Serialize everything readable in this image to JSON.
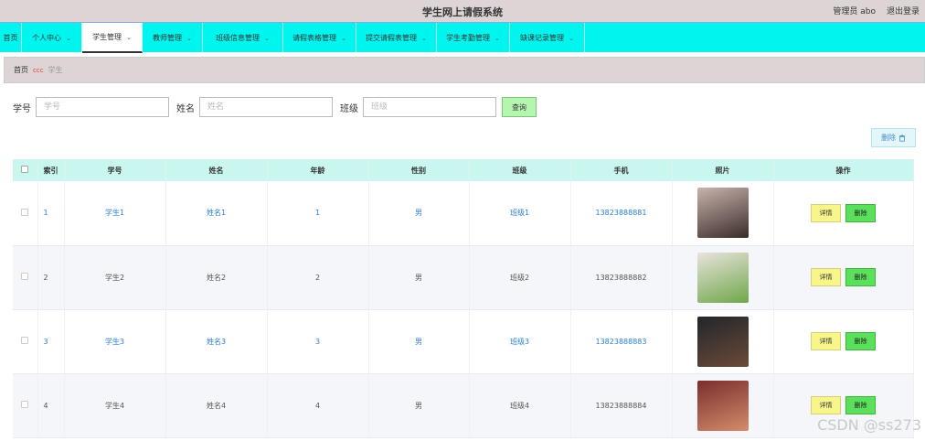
{
  "app": {
    "title": "学生网上请假系统",
    "user": "管理员 abo",
    "logout": "退出登录"
  },
  "nav": {
    "home": "首页",
    "items": [
      {
        "label": "个人中心"
      },
      {
        "label": "学生管理"
      },
      {
        "label": "教师管理"
      },
      {
        "label": "班级信息管理"
      },
      {
        "label": "请假表格管理"
      },
      {
        "label": "提交请假表管理"
      },
      {
        "label": "学生考勤管理"
      },
      {
        "label": "缺课记录管理"
      }
    ]
  },
  "breadcrumb": {
    "home": "首页",
    "separator": "ccc",
    "current": "学生"
  },
  "search": {
    "student_id_label": "学号",
    "student_id_placeholder": "学号",
    "name_label": "姓名",
    "name_placeholder": "姓名",
    "class_label": "班级",
    "class_placeholder": "班级",
    "query_button": "查询"
  },
  "toolbar": {
    "delete_label": "删除"
  },
  "table": {
    "headers": [
      "索引",
      "学号",
      "姓名",
      "年龄",
      "性别",
      "班级",
      "手机",
      "照片",
      "操作"
    ],
    "rows": [
      {
        "index": "1",
        "student_id": "学生1",
        "name": "姓名1",
        "age": "1",
        "gender": "男",
        "class": "班级1",
        "phone": "13823888881",
        "photo_colors": [
          "#c9b3ad",
          "#3a2c2a"
        ]
      },
      {
        "index": "2",
        "student_id": "学生2",
        "name": "姓名2",
        "age": "2",
        "gender": "男",
        "class": "班级2",
        "phone": "13823888882",
        "photo_colors": [
          "#e9e3dc",
          "#6fa74a"
        ]
      },
      {
        "index": "3",
        "student_id": "学生3",
        "name": "姓名3",
        "age": "3",
        "gender": "男",
        "class": "班级3",
        "phone": "13823888883",
        "photo_colors": [
          "#22262b",
          "#6b4a38"
        ]
      },
      {
        "index": "4",
        "student_id": "学生4",
        "name": "姓名4",
        "age": "4",
        "gender": "男",
        "class": "班级4",
        "phone": "13823888884",
        "photo_colors": [
          "#7a2e2e",
          "#d48c6a"
        ]
      }
    ],
    "detail_label": "详情",
    "row_delete_label": "删除"
  },
  "watermark": "CSDN @ss273",
  "colors": {
    "nav_bg": "#00f5ee",
    "header_bg": "#ddd5d5",
    "table_header_bg": "#c9f6ef",
    "link_blue": "#2a7fd4",
    "detail_btn": "#f8f58a",
    "delete_btn": "#5ae05a"
  }
}
